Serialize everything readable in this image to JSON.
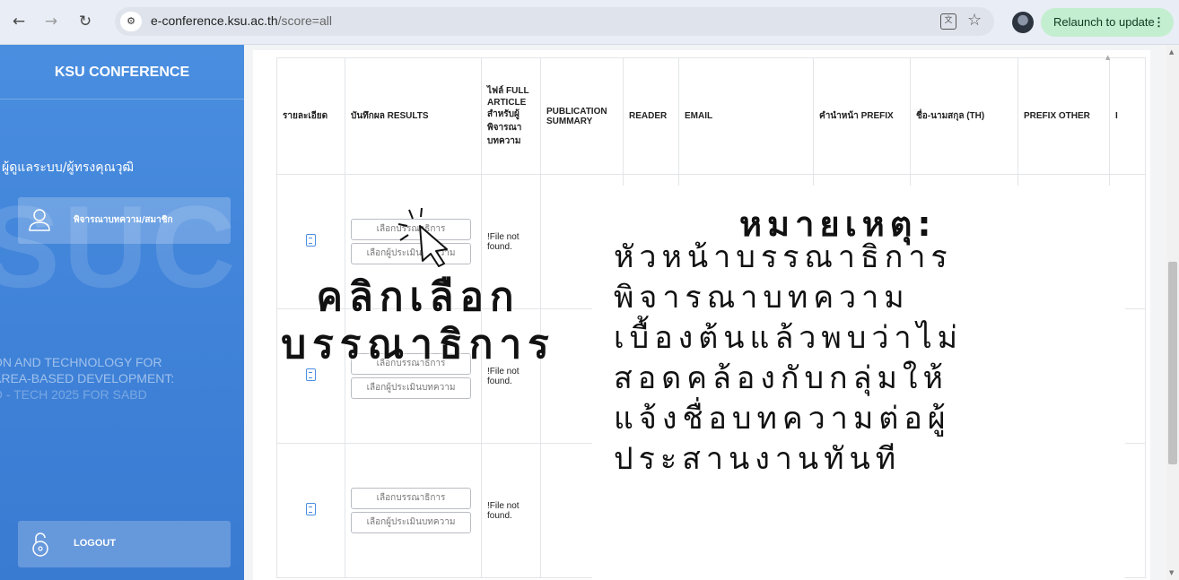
{
  "browser": {
    "url_host": "e-conference.ksu.ac.th",
    "url_path": "/score=all",
    "relaunch_label": "Relaunch to update"
  },
  "sidebar": {
    "brand": "KSU CONFERENCE",
    "role": "ผู้ดูแลระบบ/ผู้ทรงคุณวุฒิ",
    "nav_reviewer": "พิจารณาบทความ/สมาชิก",
    "watermark": "SUC",
    "watermark_lines": [
      "ON AND TECHNOLOGY FOR",
      "AREA-BASED DEVELOPMENT:",
      "O - TECH 2025 FOR SABD"
    ],
    "logout": "LOGOUT"
  },
  "table": {
    "headers": [
      "รายละเอียด",
      "บันทึกผล RESULTS",
      "ไฟล์ FULL ARTICLE สำหรับผู้พิจารณาบทความ",
      "PUBLICATION SUMMARY",
      "READER",
      "EMAIL",
      "คำนำหน้า PREFIX",
      "ชื่อ-นามสกุล (TH)",
      "PREFIX OTHER",
      "I"
    ],
    "rows": [
      {
        "btn_editor": "เลือกบรรณาธิการ",
        "btn_reviewer": "เลือกผู้ประเมินบทความ",
        "file": "!File not found."
      },
      {
        "btn_editor": "เลือกบรรณาธิการ",
        "btn_reviewer": "เลือกผู้ประเมินบทความ",
        "file": "!File not found."
      },
      {
        "btn_editor": "เลือกบรรณาธิการ",
        "btn_reviewer": "เลือกผู้ประเมินบทความ",
        "file": "!File not found."
      }
    ]
  },
  "overlay": {
    "click_caption_1": "คลิกเลือก",
    "click_caption_2": "บรรณาธิการ",
    "note_title": "หมายเหตุ:",
    "note_lines": [
      "หัวหน้าบรรณาธิการ",
      "พิจารณาบทความ",
      "เบื้องต้นแล้วพบว่าไม่",
      "สอดคล้องกับกลุ่มให้",
      "แจ้งชื่อบทความต่อผู้",
      "ประสานงานทันที"
    ]
  },
  "colors": {
    "sidebar": "#4a8ee0",
    "relaunch": "#c4eed0"
  }
}
